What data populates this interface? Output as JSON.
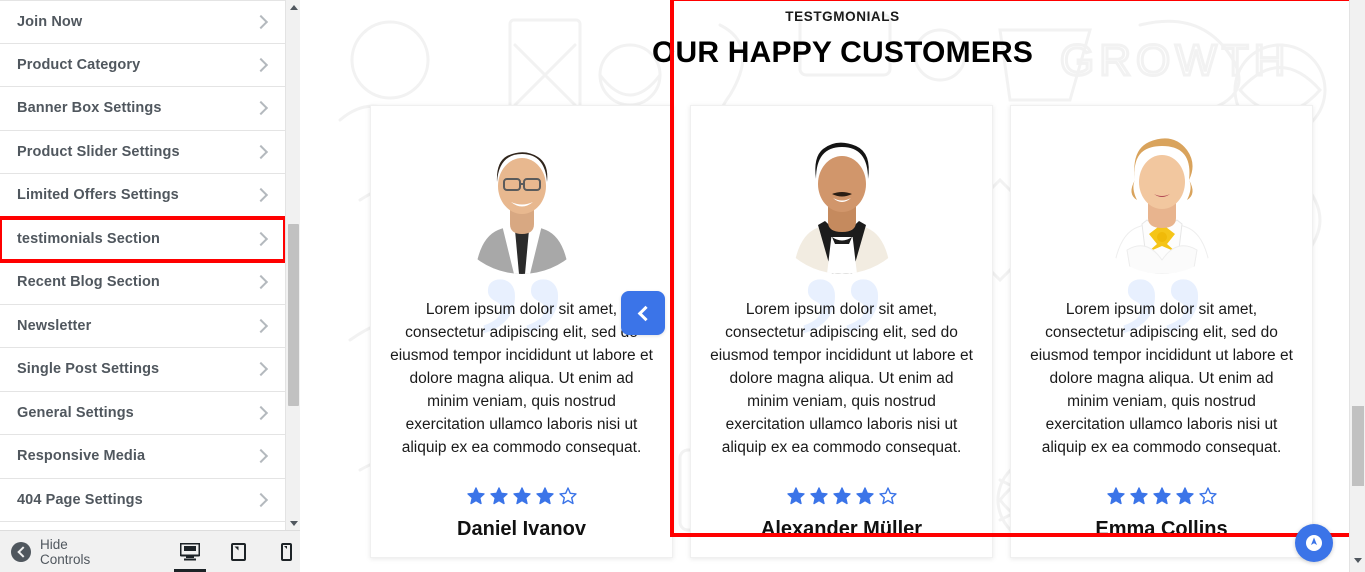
{
  "sidebar": {
    "items": [
      {
        "label": "Join Now",
        "icon": "chevron-right-icon",
        "highlighted": false
      },
      {
        "label": "Product Category",
        "icon": "chevron-right-icon",
        "highlighted": false
      },
      {
        "label": "Banner Box Settings",
        "icon": "chevron-right-icon",
        "highlighted": false
      },
      {
        "label": "Product Slider Settings",
        "icon": "chevron-right-icon",
        "highlighted": false
      },
      {
        "label": "Limited Offers Settings",
        "icon": "chevron-right-icon",
        "highlighted": false
      },
      {
        "label": "testimonials Section",
        "icon": "chevron-right-icon",
        "highlighted": true
      },
      {
        "label": "Recent Blog Section",
        "icon": "chevron-right-icon",
        "highlighted": false
      },
      {
        "label": "Newsletter",
        "icon": "chevron-right-icon",
        "highlighted": false
      },
      {
        "label": "Single Post Settings",
        "icon": "chevron-right-icon",
        "highlighted": false
      },
      {
        "label": "General Settings",
        "icon": "chevron-right-icon",
        "highlighted": false
      },
      {
        "label": "Responsive Media",
        "icon": "chevron-right-icon",
        "highlighted": false
      },
      {
        "label": "404 Page Settings",
        "icon": "chevron-right-icon",
        "highlighted": false
      }
    ],
    "footer": {
      "hide_controls_label": "Hide Controls",
      "hide_controls_icon": "circle-left-arrow-icon",
      "devices": [
        {
          "name": "desktop",
          "icon": "desktop-icon",
          "active": true
        },
        {
          "name": "tablet",
          "icon": "tablet-icon",
          "active": false
        },
        {
          "name": "mobile",
          "icon": "mobile-icon",
          "active": false
        }
      ]
    }
  },
  "preview": {
    "section": {
      "eyebrow": "TESTGMONIALS",
      "title": "OUR HAPPY CUSTOMERS"
    },
    "nav": {
      "prev_icon": "chevron-left-icon",
      "next_icon": "chevron-right-icon"
    },
    "cards": [
      {
        "avatar": "man-gray-suit-glasses-photo",
        "body": "Lorem ipsum dolor sit amet, consectetur adipiscing elit, sed do eiusmod tempor incididunt ut labore et dolore magna aliqua. Ut enim ad minim veniam, quis nostrud exercitation ullamco laboris nisi ut aliquip ex ea commodo consequat.",
        "rating": 4,
        "max_rating": 5,
        "name": "Daniel Ivanov"
      },
      {
        "avatar": "man-white-tuxedo-bowtie-photo",
        "body": "Lorem ipsum dolor sit amet, consectetur adipiscing elit, sed do eiusmod tempor incididunt ut labore et dolore magna aliqua. Ut enim ad minim veniam, quis nostrud exercitation ullamco laboris nisi ut aliquip ex ea commodo consequat.",
        "rating": 4,
        "max_rating": 5,
        "name": "Alexander Müller"
      },
      {
        "avatar": "woman-blonde-white-blouse-yellow-bow-photo",
        "body": "Lorem ipsum dolor sit amet, consectetur adipiscing elit, sed do eiusmod tempor incididunt ut labore et dolore magna aliqua. Ut enim ad minim veniam, quis nostrud exercitation ullamco laboris nisi ut aliquip ex ea commodo consequat.",
        "rating": 4,
        "max_rating": 5,
        "name": "Emma Collins"
      }
    ],
    "background_watermark_text": "GROWTH",
    "fab_icon": "pointer-circle-icon"
  },
  "colors": {
    "accent_blue": "#3b74e8",
    "star_blue": "#3b74e8",
    "highlight_red": "#ff0000",
    "sidebar_text": "#50575e",
    "quote_watermark": "#e8f0fe"
  }
}
